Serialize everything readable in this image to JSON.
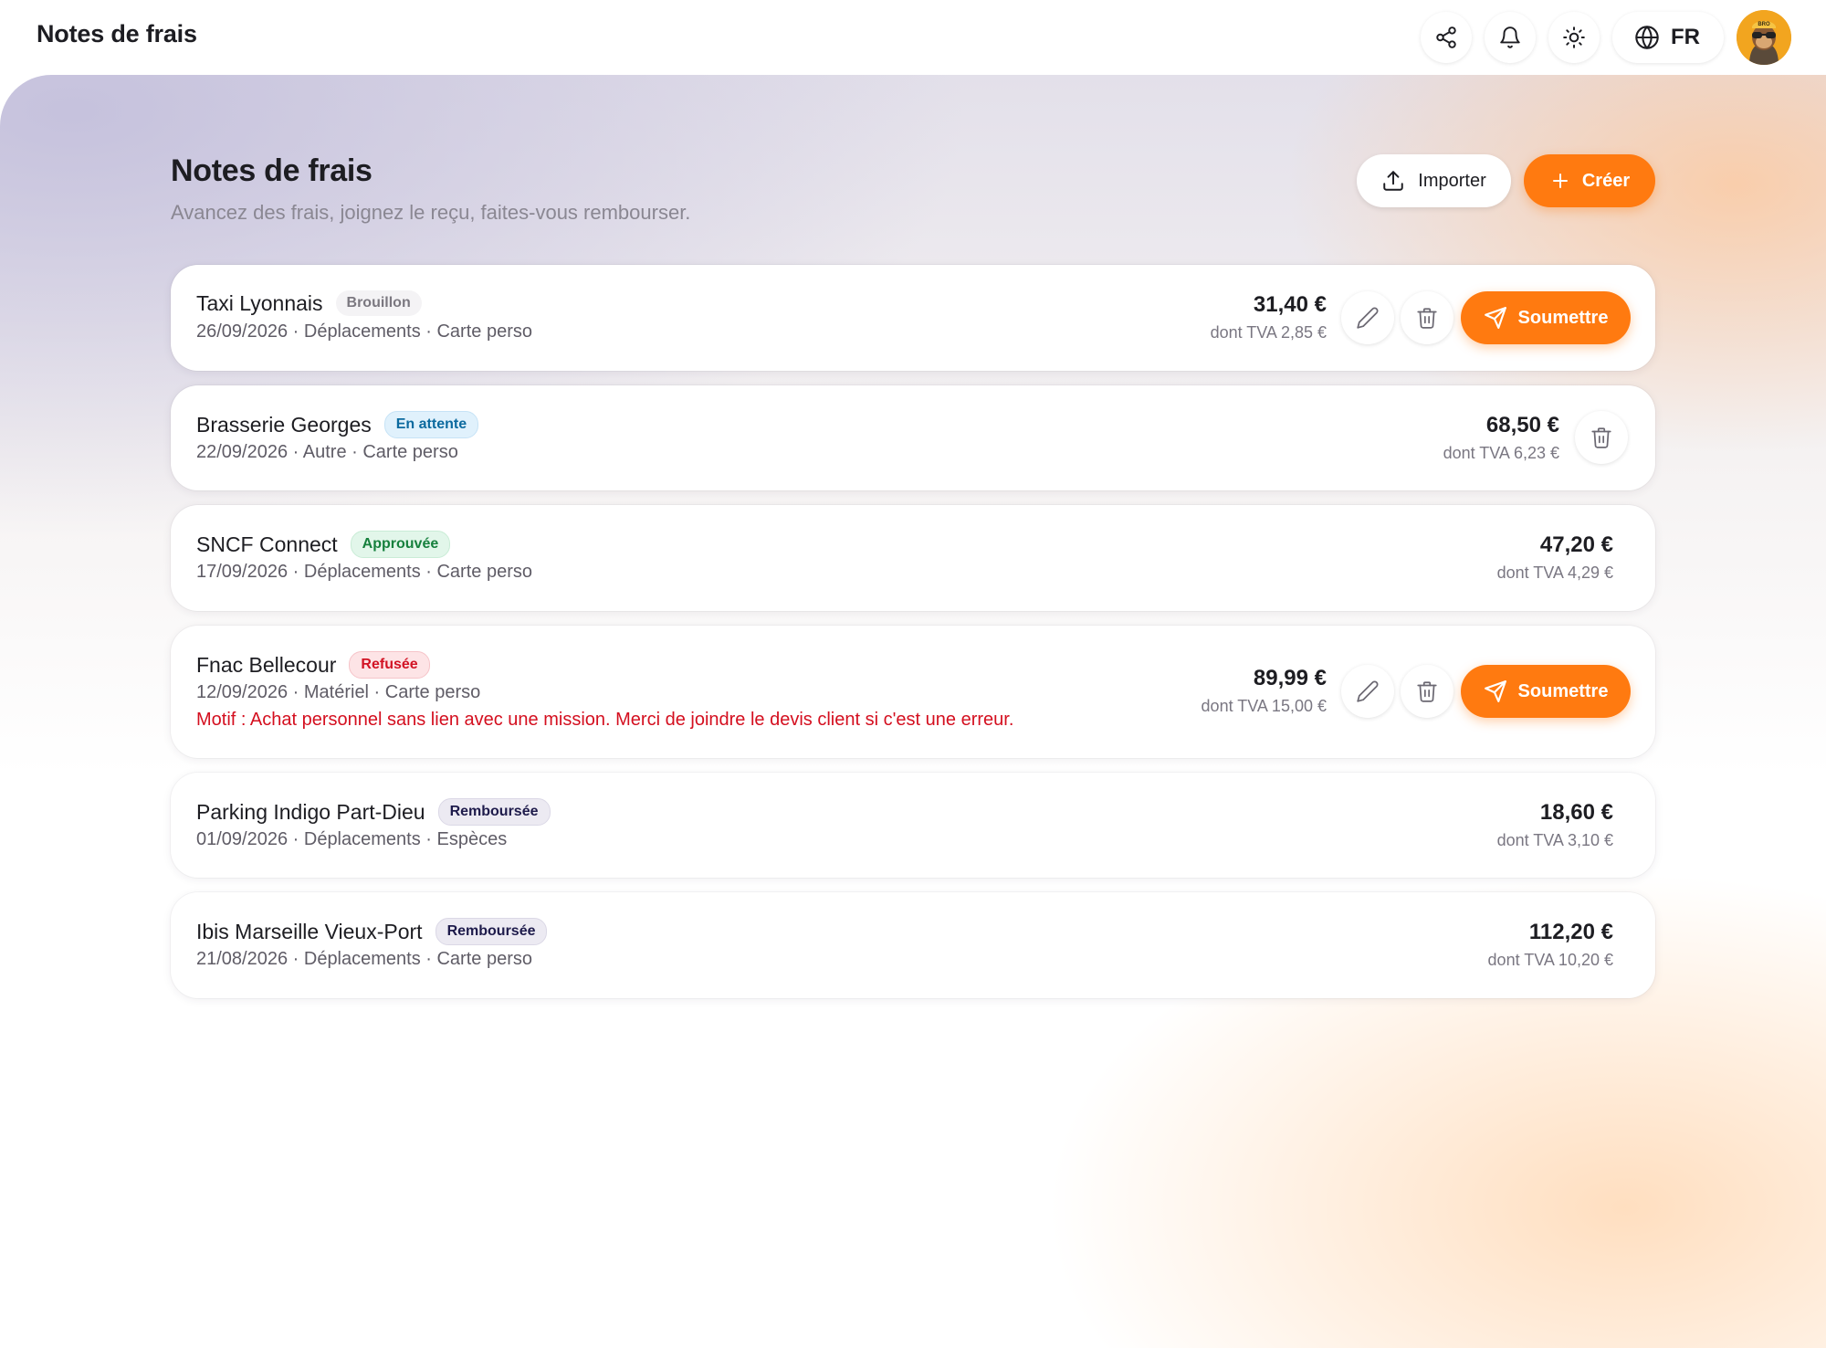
{
  "app": {
    "title": "Notes de frais"
  },
  "topbar": {
    "share_icon": "share-icon",
    "bell_icon": "bell-icon",
    "theme_icon": "sun-icon",
    "language": "FR",
    "avatar_label": "BRO"
  },
  "page": {
    "title": "Notes de frais",
    "subtitle": "Avancez des frais, joignez le reçu, faites-vous rembourser.",
    "import_label": "Importer",
    "create_label": "Créer"
  },
  "colors": {
    "accent": "#ff7a10",
    "refused_text": "#d40f1f"
  },
  "submit_label": "Soumettre",
  "expenses": [
    {
      "name": "Taxi Lyonnais",
      "status": "Brouillon",
      "meta": "26/09/2026 · Déplacements · Carte perso",
      "amount": "31,40 €",
      "vat": "dont TVA 2,85 €"
    },
    {
      "name": "Brasserie Georges",
      "status": "En attente",
      "meta": "22/09/2026 · Autre · Carte perso",
      "amount": "68,50 €",
      "vat": "dont TVA 6,23 €"
    },
    {
      "name": "SNCF Connect",
      "status": "Approuvée",
      "meta": "17/09/2026 · Déplacements · Carte perso",
      "amount": "47,20 €",
      "vat": "dont TVA 4,29 €"
    },
    {
      "name": "Fnac Bellecour",
      "status": "Refusée",
      "meta": "12/09/2026 · Matériel · Carte perso",
      "motif": "Motif : Achat personnel sans lien avec une mission. Merci de joindre le devis client si c'est une erreur.",
      "amount": "89,99 €",
      "vat": "dont TVA 15,00 €"
    },
    {
      "name": "Parking Indigo Part-Dieu",
      "status": "Remboursée",
      "meta": "01/09/2026 · Déplacements · Espèces",
      "amount": "18,60 €",
      "vat": "dont TVA 3,10 €"
    },
    {
      "name": "Ibis Marseille Vieux-Port",
      "status": "Remboursée",
      "meta": "21/08/2026 · Déplacements · Carte perso",
      "amount": "112,20 €",
      "vat": "dont TVA 10,20 €"
    }
  ]
}
